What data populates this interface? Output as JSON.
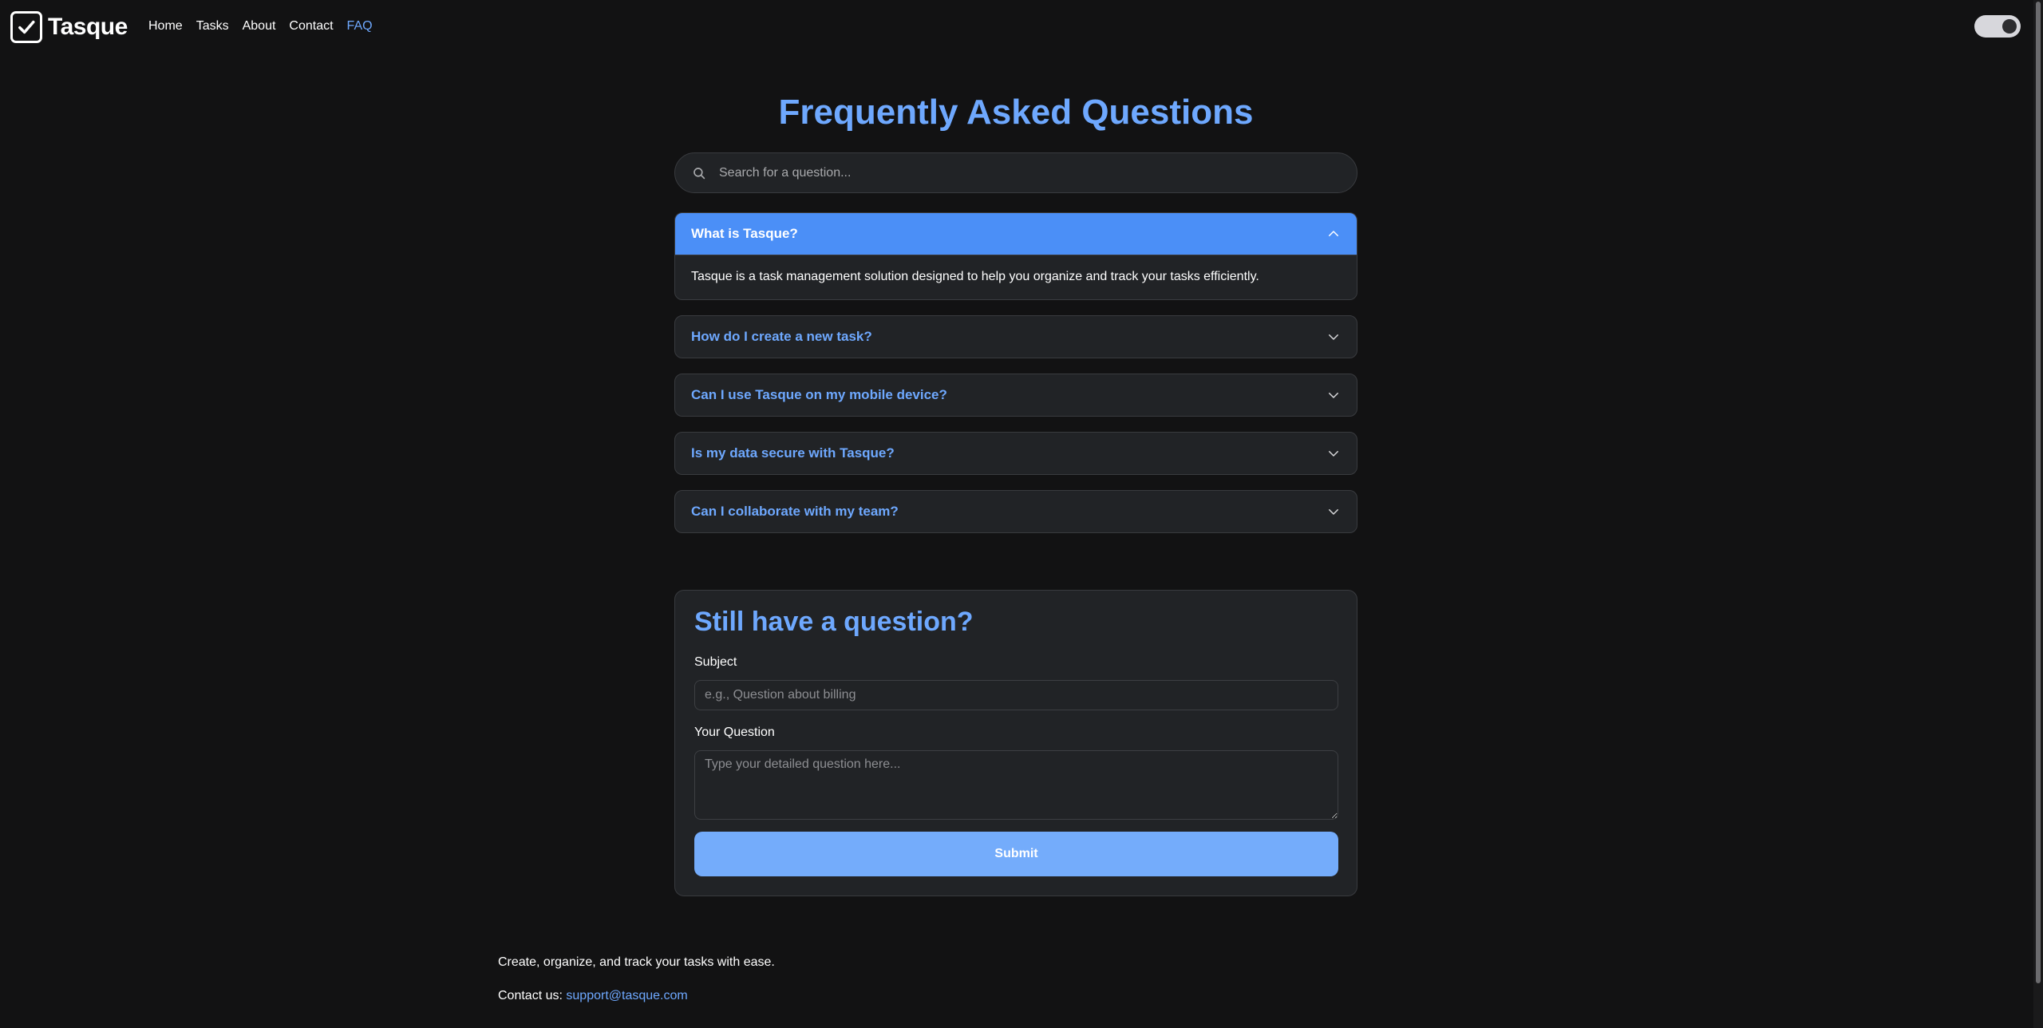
{
  "header": {
    "brand": "Tasque",
    "nav": [
      {
        "label": "Home",
        "active": false
      },
      {
        "label": "Tasks",
        "active": false
      },
      {
        "label": "About",
        "active": false
      },
      {
        "label": "Contact",
        "active": false
      },
      {
        "label": "FAQ",
        "active": true
      }
    ],
    "theme_toggle_on": true
  },
  "main": {
    "title": "Frequently Asked Questions",
    "search": {
      "placeholder": "Search for a question..."
    },
    "faqs": [
      {
        "question": "What is Tasque?",
        "answer": "Tasque is a task management solution designed to help you organize and track your tasks efficiently.",
        "expanded": true
      },
      {
        "question": "How do I create a new task?",
        "expanded": false
      },
      {
        "question": "Can I use Tasque on my mobile device?",
        "expanded": false
      },
      {
        "question": "Is my data secure with Tasque?",
        "expanded": false
      },
      {
        "question": "Can I collaborate with my team?",
        "expanded": false
      }
    ]
  },
  "contact_form": {
    "title": "Still have a question?",
    "subject_label": "Subject",
    "subject_placeholder": "e.g., Question about billing",
    "question_label": "Your Question",
    "question_placeholder": "Type your detailed question here...",
    "submit_label": "Submit"
  },
  "footer": {
    "tagline": "Create, organize, and track your tasks with ease.",
    "contact_prefix": "Contact us:",
    "email": "support@tasque.com"
  },
  "colors": {
    "background": "#121213",
    "surface": "#212326",
    "accent": "#6ea8fe",
    "active_header": "#4b8ff7",
    "button": "#74acfb"
  }
}
